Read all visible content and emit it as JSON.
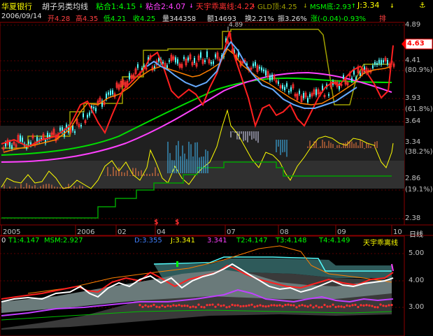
{
  "title_bar": {
    "stock_name": "华夏银行",
    "indicator_name": "胡子另类均线",
    "line1": "粘合1:4.15",
    "line2": "粘合2:4.07",
    "line3": "天宇乖离线:4.22",
    "line4": "GLD顶:4.25",
    "line5": "MSM底:2.93",
    "line6": "J:3.34",
    "arrow_down": "↓",
    "arrow_up": "↑",
    "anchor_icon": "anchor-icon"
  },
  "info_bar": {
    "date": "2006/09/14",
    "open": "开4.28",
    "high": "高4.35",
    "low": "低4.21",
    "close": "收4.25",
    "volume": "量344358",
    "amount": "额14693",
    "turnover": "换2.21%",
    "amplitude": "振3.26%",
    "change": "涨(-0.04)-0.93%",
    "tail": "排"
  },
  "main_chart": {
    "y_labels": [
      {
        "text": "4.89",
        "color": "#c0c0c0"
      },
      {
        "text": "4.63",
        "color": "#ff4040"
      },
      {
        "text": "4.41",
        "color": "#c0c0c0"
      },
      {
        "text": "(80.9%)",
        "color": "#c0c0c0"
      },
      {
        "text": "3.93",
        "color": "#c0c0c0"
      },
      {
        "text": "(61.8%)",
        "color": "#c0c0c0"
      },
      {
        "text": "3.64",
        "color": "#c0c0c0"
      },
      {
        "text": "3.34",
        "color": "#c0c0c0"
      },
      {
        "text": "(38.2%)",
        "color": "#c0c0c0"
      },
      {
        "text": "2.86",
        "color": "#c0c0c0"
      },
      {
        "text": "(19.1%)",
        "color": "#c0c0c0"
      },
      {
        "text": "2.38",
        "color": "#c0c0c0"
      }
    ],
    "peak_label": "4.89",
    "current_price_box": "4.63",
    "signal_marks": [
      "$",
      "$"
    ]
  },
  "x_axis": {
    "labels": [
      "2005",
      "2006",
      "02",
      "04",
      "07",
      "08",
      "09",
      "10"
    ],
    "period": "日线"
  },
  "sub_title": {
    "prefix": "0",
    "t1": "T1:4.147",
    "msm": "MSM:2.927",
    "d": "D:3.355",
    "j": "J:3.341",
    "val": "3.341",
    "t2": "T2:4.147",
    "t3": "T3:4.148",
    "t4": "T4:4.149",
    "name": "天宇乖离线"
  },
  "sub_chart": {
    "y_labels": [
      "5.00",
      "4.00",
      "3.00"
    ]
  },
  "colors": {
    "up": "#ff3030",
    "down": "#54ffff",
    "green_line": "#00e000",
    "magenta_line": "#ff40ff",
    "olive_line": "#a0a000",
    "orange_line": "#ff8000",
    "yellow_line": "#ffff00",
    "dark_green_line": "#00a000"
  }
}
